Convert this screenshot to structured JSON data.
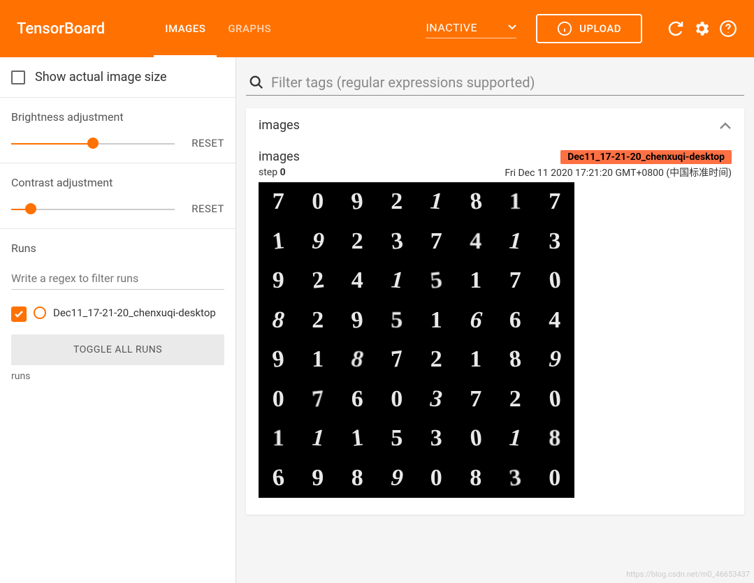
{
  "header": {
    "logo": "TensorBoard",
    "tabs": [
      "IMAGES",
      "GRAPHS"
    ],
    "active_tab": 0,
    "inactive_label": "INACTIVE",
    "upload_label": "UPLOAD"
  },
  "sidebar": {
    "show_actual_label": "Show actual image size",
    "brightness": {
      "label": "Brightness adjustment",
      "value_percent": 50,
      "reset": "RESET"
    },
    "contrast": {
      "label": "Contrast adjustment",
      "value_percent": 12,
      "reset": "RESET"
    },
    "runs_label": "Runs",
    "runs_filter_placeholder": "Write a regex to filter runs",
    "runs": [
      {
        "name": "Dec11_17-21-20_chenxuqi-desktop",
        "checked": true
      }
    ],
    "toggle_all": "TOGGLE ALL RUNS",
    "runs_footer": "runs"
  },
  "main": {
    "filter_placeholder": "Filter tags (regular expressions supported)",
    "card_title": "images",
    "image_card": {
      "title": "images",
      "run_tag": "Dec11_17-21-20_chenxuqi-desktop",
      "step_label": "step",
      "step_value": "0",
      "timestamp": "Fri Dec 11 2020 17:21:20 GMT+0800 (中国标准时间)",
      "digits": [
        [
          "7",
          "0",
          "9",
          "2",
          "1",
          "8",
          "1",
          "7"
        ],
        [
          "1",
          "9",
          "2",
          "3",
          "7",
          "4",
          "1",
          "3"
        ],
        [
          "9",
          "2",
          "4",
          "1",
          "5",
          "1",
          "7",
          "0"
        ],
        [
          "8",
          "2",
          "9",
          "5",
          "1",
          "6",
          "6",
          "4"
        ],
        [
          "9",
          "1",
          "8",
          "7",
          "2",
          "1",
          "8",
          "9"
        ],
        [
          "0",
          "7",
          "6",
          "0",
          "3",
          "7",
          "2",
          "0"
        ],
        [
          "1",
          "1",
          "1",
          "5",
          "3",
          "0",
          "1",
          "8"
        ],
        [
          "6",
          "9",
          "8",
          "9",
          "0",
          "8",
          "3",
          "0"
        ]
      ]
    }
  },
  "watermark": "https://blog.csdn.net/m0_46653437"
}
